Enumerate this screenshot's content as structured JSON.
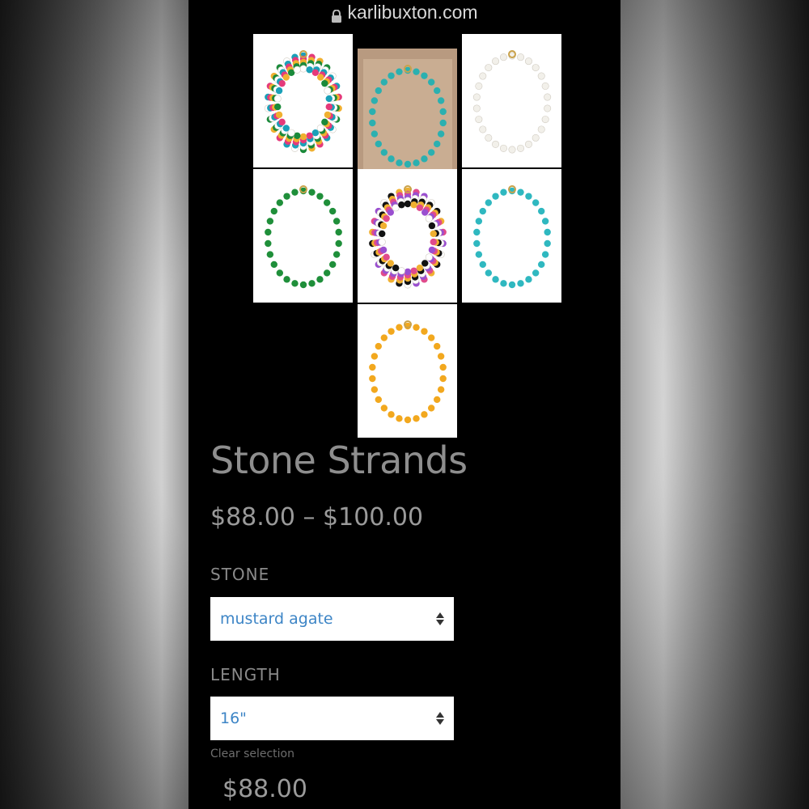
{
  "browser": {
    "url": "karlibuxton.com"
  },
  "gallery": {
    "thumbnails": [
      {
        "alt": "layered-necklaces",
        "colors": [
          "#1aa0b8",
          "#e53a7a",
          "#f0b030",
          "#1a8a3a",
          "#ffffff"
        ]
      },
      {
        "alt": "necklaces-on-model",
        "colors": [
          "#2bb0b0"
        ]
      },
      {
        "alt": "white-necklace",
        "colors": [
          "#f2f0ea"
        ]
      },
      {
        "alt": "green-necklace",
        "colors": [
          "#1f8f3a"
        ]
      },
      {
        "alt": "multicolor-necklace",
        "colors": [
          "#f0b030",
          "#e04b8c",
          "#9a4fd0",
          "#ffffff",
          "#111111"
        ]
      },
      {
        "alt": "turquoise-necklace",
        "colors": [
          "#2fb8c0"
        ]
      },
      {
        "alt": "mustard-necklace",
        "colors": [
          "#f2a81e"
        ]
      }
    ]
  },
  "product": {
    "title": "Stone Strands",
    "price_range": "$88.00 – $100.00",
    "stone_label": "STONE",
    "stone_value": "mustard agate",
    "length_label": "LENGTH",
    "length_value": "16\"",
    "clear_label": "Clear selection",
    "price": "$88.00"
  }
}
